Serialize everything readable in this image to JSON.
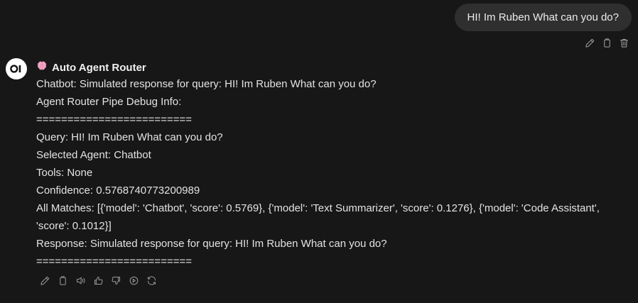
{
  "user_message": {
    "text": "HI! Im Ruben What can you do?",
    "actions": [
      "edit-icon",
      "copy-icon",
      "delete-icon"
    ]
  },
  "assistant": {
    "avatar_text": "OI",
    "model_emoji": "🧠",
    "model_name": "Auto Agent Router",
    "lines": [
      "Chatbot: Simulated response for query: HI! Im Ruben What can you do?",
      "Agent Router Pipe Debug Info:",
      "=========================",
      "Query: HI! Im Ruben What can you do?",
      "Selected Agent: Chatbot",
      "Tools: None",
      "Confidence: 0.5768740773200989",
      "All Matches: [{'model': 'Chatbot', 'score': 0.5769}, {'model': 'Text Summarizer', 'score': 0.1276}, {'model': 'Code Assistant', 'score': 0.1012}]",
      "Response: Simulated response for query: HI! Im Ruben What can you do?",
      "========================="
    ],
    "actions": [
      "edit-icon",
      "copy-icon",
      "read-aloud-icon",
      "thumbs-up-icon",
      "thumbs-down-icon",
      "continue-icon",
      "regenerate-icon"
    ]
  },
  "colors": {
    "background": "#171717",
    "bubble": "#2f2f2f",
    "text": "#e3e3e3",
    "icon": "#a3a3a3"
  }
}
